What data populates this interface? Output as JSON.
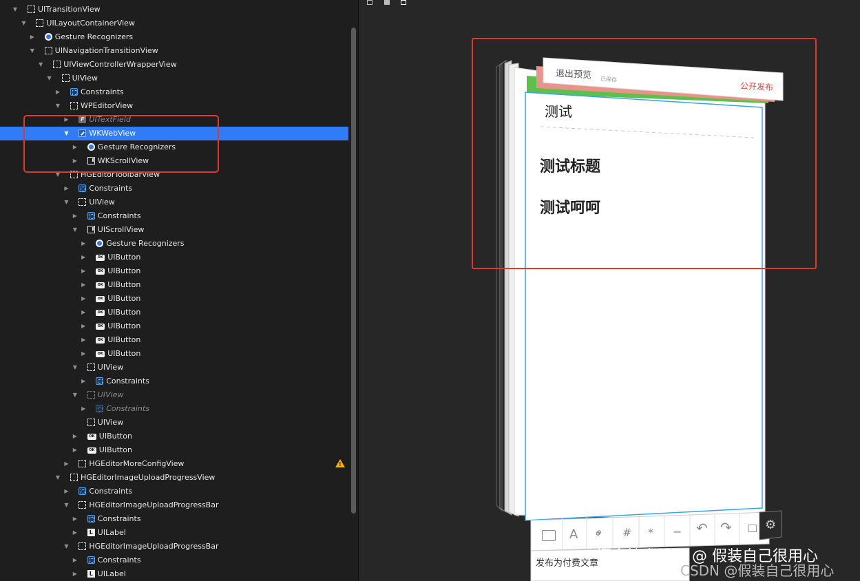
{
  "hierarchy": [
    {
      "label": "UITransitionView",
      "indent": 0,
      "icon": "view",
      "arrow": "down"
    },
    {
      "label": "UILayoutContainerView",
      "indent": 1,
      "icon": "view",
      "arrow": "down"
    },
    {
      "label": "Gesture Recognizers",
      "indent": 2,
      "icon": "gesture",
      "arrow": "right"
    },
    {
      "label": "UINavigationTransitionView",
      "indent": 2,
      "icon": "view",
      "arrow": "down"
    },
    {
      "label": "UIViewControllerWrapperView",
      "indent": 3,
      "icon": "view",
      "arrow": "down"
    },
    {
      "label": "UIView",
      "indent": 4,
      "icon": "view",
      "arrow": "down"
    },
    {
      "label": "Constraints",
      "indent": 5,
      "icon": "constraints",
      "arrow": "right"
    },
    {
      "label": "WPEditorView",
      "indent": 5,
      "icon": "view",
      "arrow": "down"
    },
    {
      "label": "UITextField",
      "indent": 6,
      "icon": "textfield",
      "arrow": "right",
      "dim": true
    },
    {
      "label": "WKWebView",
      "indent": 6,
      "icon": "webview",
      "arrow": "down",
      "selected": true
    },
    {
      "label": "Gesture Recognizers",
      "indent": 7,
      "icon": "gesture",
      "arrow": "right"
    },
    {
      "label": "WKScrollView",
      "indent": 7,
      "icon": "scrollview",
      "arrow": "right"
    },
    {
      "label": "HGEditorToolbarView",
      "indent": 5,
      "icon": "view",
      "arrow": "down"
    },
    {
      "label": "Constraints",
      "indent": 6,
      "icon": "constraints",
      "arrow": "right"
    },
    {
      "label": "UIView",
      "indent": 6,
      "icon": "view",
      "arrow": "down"
    },
    {
      "label": "Constraints",
      "indent": 7,
      "icon": "constraints",
      "arrow": "right"
    },
    {
      "label": "UIScrollView",
      "indent": 7,
      "icon": "scrollview",
      "arrow": "down"
    },
    {
      "label": "Gesture Recognizers",
      "indent": 8,
      "icon": "gesture",
      "arrow": "right"
    },
    {
      "label": "UIButton",
      "indent": 8,
      "icon": "button",
      "arrow": "right"
    },
    {
      "label": "UIButton",
      "indent": 8,
      "icon": "button",
      "arrow": "right"
    },
    {
      "label": "UIButton",
      "indent": 8,
      "icon": "button",
      "arrow": "right"
    },
    {
      "label": "UIButton",
      "indent": 8,
      "icon": "button",
      "arrow": "right"
    },
    {
      "label": "UIButton",
      "indent": 8,
      "icon": "button",
      "arrow": "right"
    },
    {
      "label": "UIButton",
      "indent": 8,
      "icon": "button",
      "arrow": "right"
    },
    {
      "label": "UIButton",
      "indent": 8,
      "icon": "button",
      "arrow": "right"
    },
    {
      "label": "UIButton",
      "indent": 8,
      "icon": "button",
      "arrow": "right"
    },
    {
      "label": "UIView",
      "indent": 7,
      "icon": "view",
      "arrow": "down"
    },
    {
      "label": "Constraints",
      "indent": 8,
      "icon": "constraints",
      "arrow": "right"
    },
    {
      "label": "UIView",
      "indent": 7,
      "icon": "view",
      "arrow": "down",
      "dim": true
    },
    {
      "label": "Constraints",
      "indent": 8,
      "icon": "constraints",
      "arrow": "right",
      "dim": true
    },
    {
      "label": "UIView",
      "indent": 7,
      "icon": "view",
      "arrow": "none"
    },
    {
      "label": "UIButton",
      "indent": 7,
      "icon": "button",
      "arrow": "right"
    },
    {
      "label": "UIButton",
      "indent": 7,
      "icon": "button",
      "arrow": "right"
    },
    {
      "label": "HGEditorMoreConfigView",
      "indent": 6,
      "icon": "view",
      "arrow": "right",
      "warning": true
    },
    {
      "label": "HGEditorImageUploadProgressView",
      "indent": 5,
      "icon": "view",
      "arrow": "down"
    },
    {
      "label": "Constraints",
      "indent": 6,
      "icon": "constraints",
      "arrow": "right"
    },
    {
      "label": "HGEditorImageUploadProgressBar",
      "indent": 6,
      "icon": "view",
      "arrow": "down"
    },
    {
      "label": "Constraints",
      "indent": 7,
      "icon": "constraints",
      "arrow": "right"
    },
    {
      "label": "UILabel",
      "indent": 7,
      "icon": "label",
      "arrow": "right"
    },
    {
      "label": "HGEditorImageUploadProgressBar",
      "indent": 6,
      "icon": "view",
      "arrow": "down"
    },
    {
      "label": "Constraints",
      "indent": 7,
      "icon": "constraints",
      "arrow": "right"
    },
    {
      "label": "UILabel",
      "indent": 7,
      "icon": "label",
      "arrow": "right"
    }
  ],
  "preview": {
    "exit_label": "退出预览",
    "saved_label": "已保存",
    "publish_label": "公开发布",
    "doc_title": "测试",
    "heading1": "测试标题",
    "heading2": "测试呵呵",
    "footer_text": "发布为付费文章",
    "toolbar_icons": [
      "image-icon",
      "text-format-icon",
      "link-icon",
      "hashtag-icon",
      "star-icon",
      "divider-icon",
      "undo-icon",
      "redo-icon"
    ],
    "accent_blue": "#2fa8e8",
    "accent_green": "#5cc04a",
    "accent_salmon": "#e8948a",
    "publish_color": "#e0483a"
  },
  "watermark": {
    "main": "掘金技术社区 @ 假装自己很用心",
    "sub": "CSDN @假装自己很用心"
  },
  "colors": {
    "selection": "#2f7cf6",
    "highlight_box": "#e1382c",
    "warning": "#f4b400"
  }
}
